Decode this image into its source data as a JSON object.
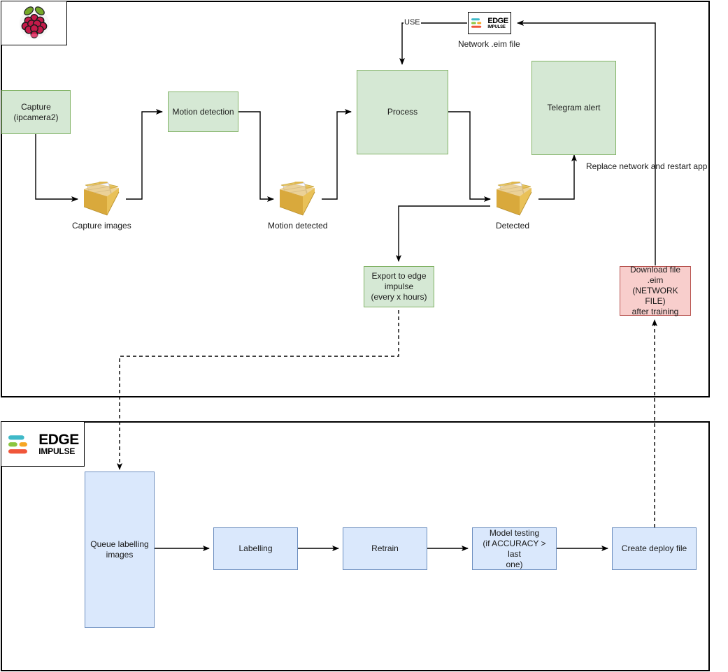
{
  "diagram": {
    "title": "Raspberry Pi and Edge Impulse retraining pipeline",
    "colors": {
      "green_fill": "#d5e8d4",
      "green_stroke": "#82b366",
      "blue_fill": "#dae8fc",
      "blue_stroke": "#6c8ebf",
      "pink_fill": "#f8cecc",
      "pink_stroke": "#b85450",
      "line": "#000000",
      "folder_body": "#d9a93c",
      "folder_back": "#e7c765",
      "paper": "#f2f2f7",
      "raspberry_red": "#c51a4a",
      "raspberry_green": "#75a928",
      "ei_cyan": "#3fb9c8",
      "ei_green": "#8cc63f",
      "ei_orange": "#f6a623",
      "ei_red": "#f0563a"
    }
  },
  "containers": {
    "device": {
      "label": ""
    },
    "cloud": {
      "label": ""
    }
  },
  "logos": {
    "raspberry_pi": {
      "name": "raspberry-pi-logo",
      "alt": "Raspberry Pi"
    },
    "edge_impulse_top": {
      "name": "edge-impulse-logo",
      "edge": "EDGE",
      "impulse": "IMPULSE"
    },
    "edge_impulse_bottom": {
      "name": "edge-impulse-logo",
      "edge": "EDGE",
      "impulse": "IMPULSE"
    }
  },
  "top_flow": {
    "capture": {
      "line1": "Capture",
      "line2": "(ipcamera2)"
    },
    "motion_detection": {
      "label": "Motion detection"
    },
    "process": {
      "label": "Process"
    },
    "telegram_alert": {
      "label": "Telegram alert"
    },
    "export": {
      "line1": "Export to edge",
      "line2": "impulse",
      "line3": "(every x hours)"
    },
    "download": {
      "line1": "Download file .eim",
      "line2": "(NETWORK FILE)",
      "line3": "after training"
    }
  },
  "folders": {
    "capture_images": {
      "label": "Capture images"
    },
    "motion_detected": {
      "label": "Motion detected"
    },
    "detected": {
      "label": "Detected"
    }
  },
  "labels": {
    "network_eim_file": "Network .eim file",
    "use": "USE",
    "replace_network": "Replace network and restart app"
  },
  "bottom_flow": {
    "queue": {
      "line1": "Queue labelling",
      "line2": "images"
    },
    "labelling": {
      "label": "Labelling"
    },
    "retrain": {
      "label": "Retrain"
    },
    "model_testing": {
      "line1": "Model testing",
      "line2": "(if ACCURACY > last",
      "line3": "one)"
    },
    "create_deploy": {
      "label": "Create deploy file"
    }
  }
}
